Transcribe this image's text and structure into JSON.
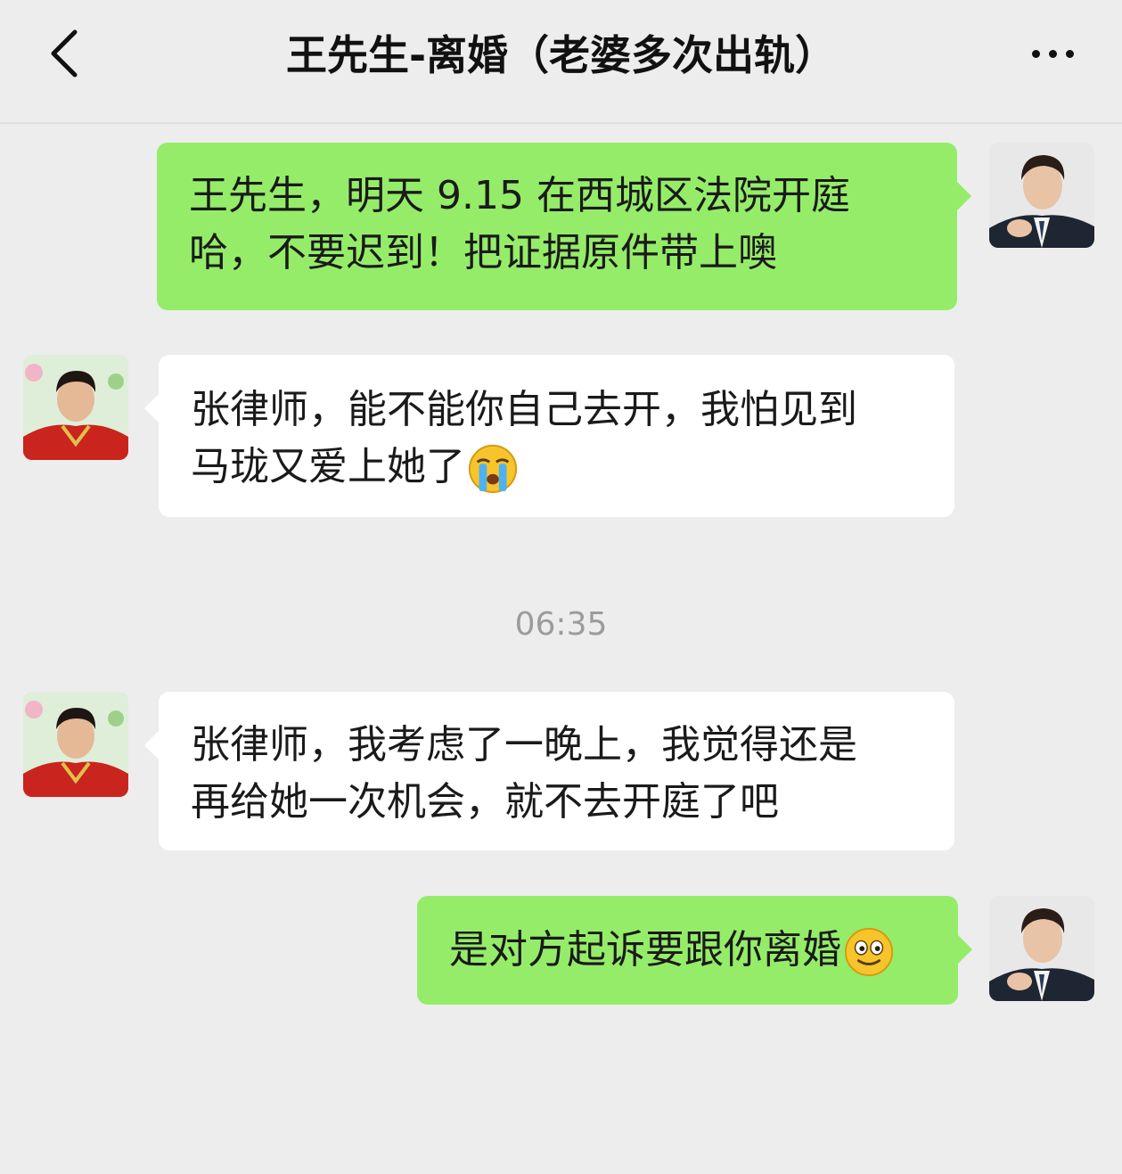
{
  "header": {
    "title": "王先生-离婚（老婆多次出轨）"
  },
  "messages": [
    {
      "side": "sent",
      "lines": [
        "王先生，明天 9.15 在西城区法院开庭",
        "哈，不要迟到！把证据原件带上噢"
      ]
    },
    {
      "side": "received",
      "lines": [
        "张律师，能不能你自己去开，我怕见到",
        "马珑又爱上她了"
      ],
      "emoji": "crying-face"
    },
    {
      "side": "received",
      "lines": [
        "张律师，我考虑了一晚上，我觉得还是",
        "再给她一次机会，就不去开庭了吧"
      ]
    },
    {
      "side": "sent",
      "lines": [
        "是对方起诉要跟你离婚"
      ],
      "emoji": "smiling-face"
    }
  ],
  "timestamp": "06:35",
  "colors": {
    "background": "#ededed",
    "sent_bubble": "#95ec69",
    "received_bubble": "#ffffff"
  }
}
